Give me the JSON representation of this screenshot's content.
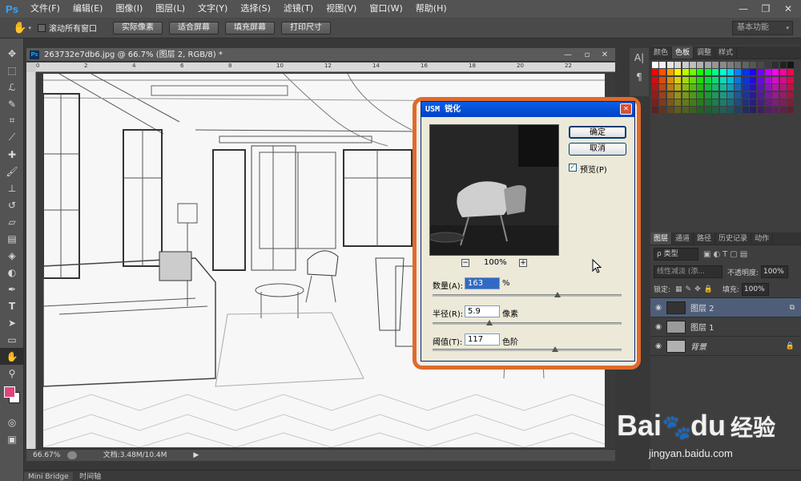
{
  "menubar": {
    "logo": "Ps",
    "items": [
      "文件(F)",
      "编辑(E)",
      "图像(I)",
      "图层(L)",
      "文字(Y)",
      "选择(S)",
      "滤镜(T)",
      "视图(V)",
      "窗口(W)",
      "帮助(H)"
    ],
    "min": "—",
    "restore": "❐",
    "close": "✕"
  },
  "optionsbar": {
    "scroll_all": "滚动所有窗口",
    "actual_pixels": "实际像素",
    "fit_screen": "适合屏幕",
    "fill_screen": "填充屏幕",
    "print_size": "打印尺寸",
    "workspace": "基本功能"
  },
  "document": {
    "tab_title": "263732e7db6.jpg @ 66.7% (图层 2, RGB/8) *",
    "zoom": "66.67%",
    "doc_info": "文档:3.48M/10.4M",
    "ruler_marks": [
      "0",
      "2",
      "4",
      "6",
      "8",
      "10",
      "12",
      "14",
      "16",
      "18",
      "20",
      "22"
    ]
  },
  "dialog": {
    "title": "USM 锐化",
    "ok": "确定",
    "cancel": "取消",
    "preview_label": "预览(P)",
    "preview_checked": true,
    "zoom": "100%",
    "amount_label": "数量(A):",
    "amount_value": "163",
    "amount_unit": "%",
    "amount_level": 0.66,
    "radius_label": "半径(R):",
    "radius_value": "5.9",
    "radius_unit": "像素",
    "radius_level": 0.3,
    "threshold_label": "阈值(T):",
    "threshold_value": "117",
    "threshold_unit": "色阶",
    "threshold_level": 0.65
  },
  "panels": {
    "color_tabs": [
      "颜色",
      "色板",
      "调整",
      "样式"
    ],
    "layer_tabs": [
      "图层",
      "通道",
      "路径",
      "历史记录",
      "动作"
    ],
    "kind_filter": "ρ 类型",
    "blend_mode": "线性减淡 (添...",
    "opacity_label": "不透明度:",
    "opacity_value": "100%",
    "lock_label": "锁定:",
    "fill_label": "填充:",
    "fill_value": "100%",
    "layers": [
      {
        "name": "图层 2",
        "selected": true
      },
      {
        "name": "图层 1",
        "selected": false
      },
      {
        "name": "背景",
        "selected": false
      }
    ]
  },
  "bottom": {
    "tabs": [
      "Mini Bridge",
      "时间轴"
    ]
  },
  "watermark": {
    "brand_a": "Bai",
    "brand_b": "du",
    "brand_cn": "经验",
    "url": "jingyan.baidu.com"
  },
  "colors": {
    "accent_orange": "#e06a2a",
    "selected_layer": "#4f5e78",
    "foreground_swatch": "#e0447c",
    "xp_title": "#0a5fe8"
  }
}
